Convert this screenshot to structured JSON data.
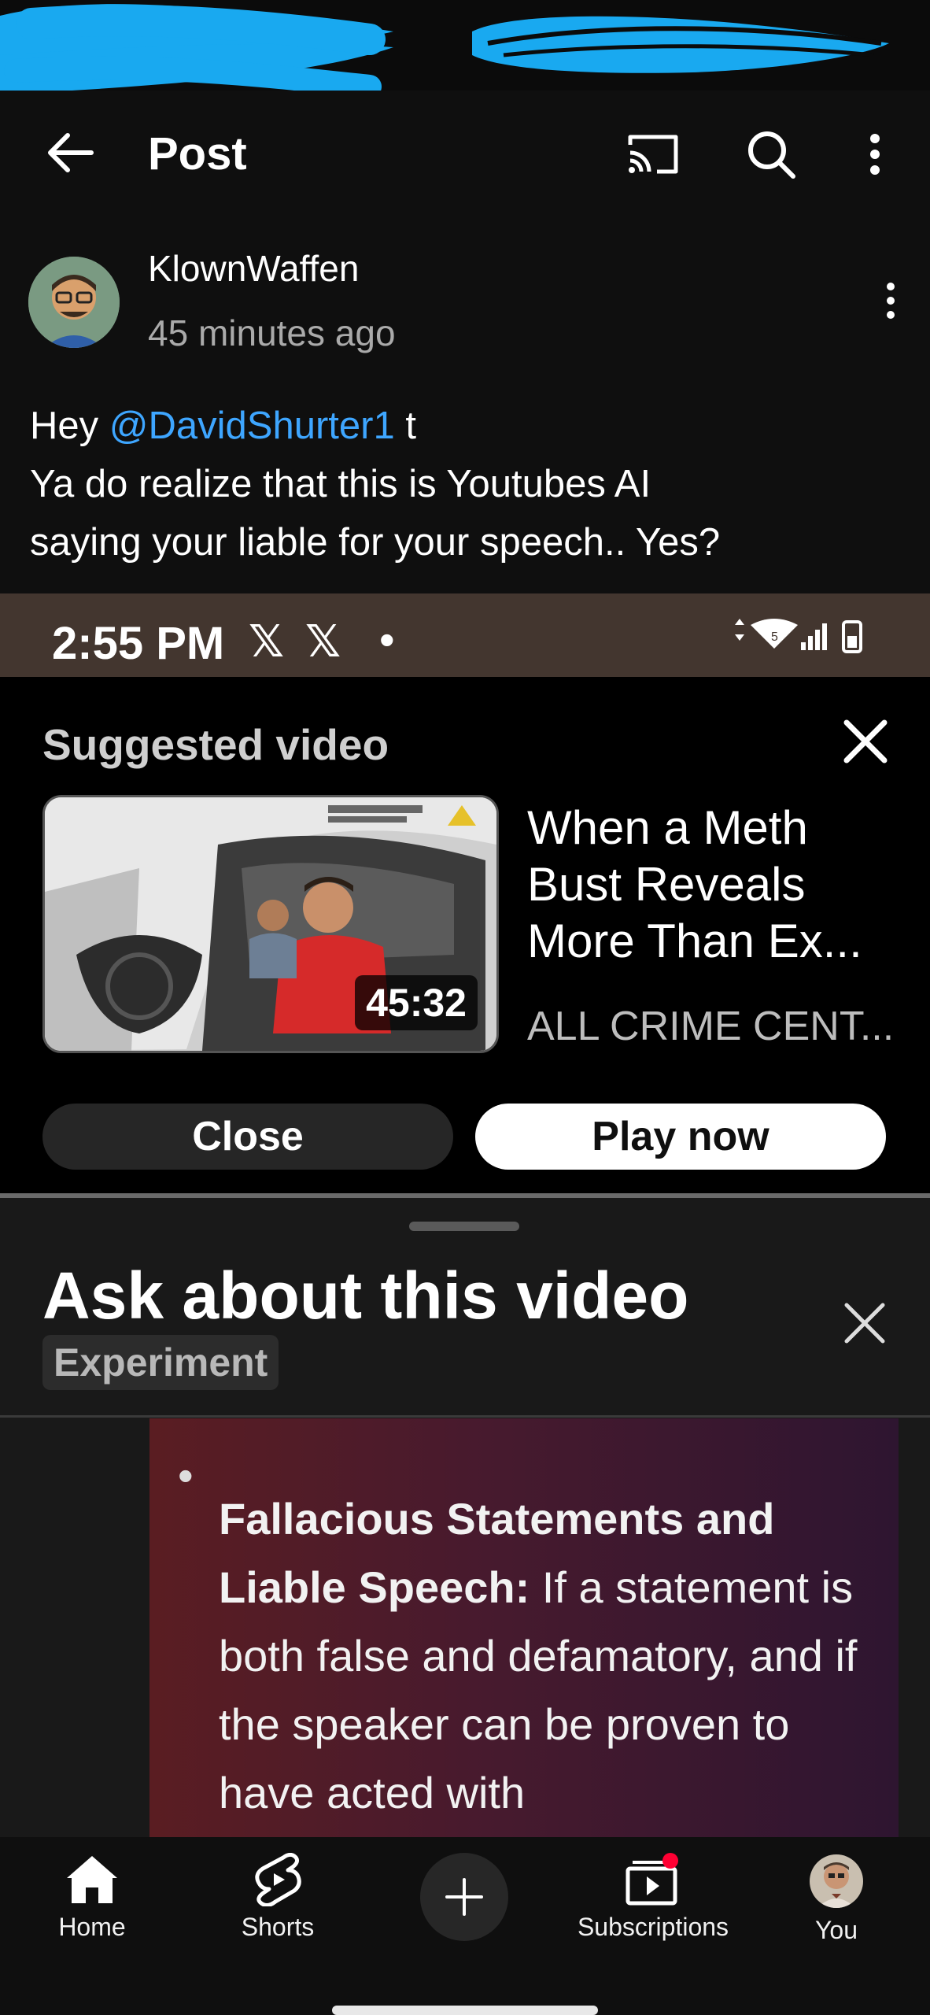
{
  "header": {
    "title": "Post"
  },
  "post": {
    "author": "KlownWaffen",
    "time": "45 minutes ago",
    "text_line1_prefix": "Hey ",
    "mention": "@DavidShurter1",
    "text_line1_suffix": " t",
    "text_line2": "Ya do realize that this is Youtubes AI",
    "text_line3": "saying your liable for your speech.. Yes?"
  },
  "embedded": {
    "status_time": "2:55 PM",
    "status_x1": "𝕏",
    "status_x2": "𝕏",
    "status_dot": "•",
    "suggested_title": "Suggested video",
    "video_title": "When a Meth Bust Reveals More Than Ex...",
    "video_channel": "ALL CRIME CENT...",
    "video_duration": "45:32",
    "close_label": "Close",
    "play_label": "Play now"
  },
  "ask_panel": {
    "title": "Ask about this video",
    "badge": "Experiment",
    "bullet_heading": "Fallacious Statements and Liable Speech:",
    "bullet_body": " If a statement is both false and defamatory, and if the speaker can be proven to have acted with"
  },
  "nav": {
    "home": "Home",
    "shorts": "Shorts",
    "subscriptions": "Subscriptions",
    "you": "You"
  },
  "colors": {
    "background": "#0f0f0f",
    "mention": "#3ea6ff",
    "scribble": "#19a9f0",
    "notification_dot": "#ff0033"
  }
}
